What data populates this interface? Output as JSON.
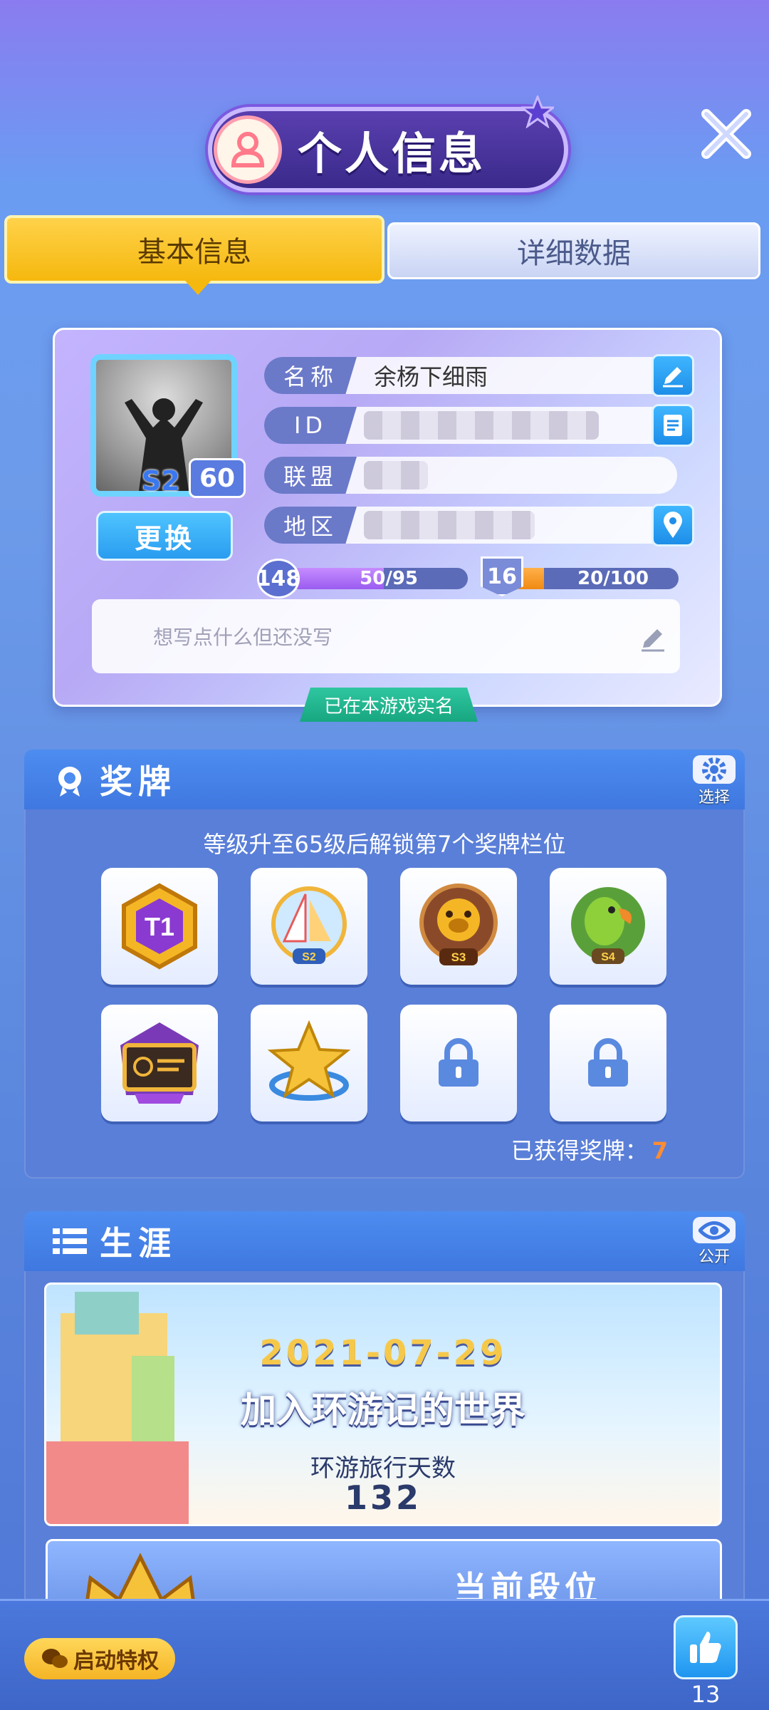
{
  "header": {
    "title": "个人信息"
  },
  "tabs": [
    {
      "label": "基本信息",
      "active": true
    },
    {
      "label": "详细数据",
      "active": false
    }
  ],
  "profile": {
    "avatar_level": "60",
    "avatar_season": "S2",
    "change_label": "更换",
    "rows": [
      {
        "label": "名称",
        "value": "余杨下细雨"
      },
      {
        "label": "ID",
        "value": ""
      },
      {
        "label": "联盟",
        "value": ""
      },
      {
        "label": "地区",
        "value": ""
      }
    ],
    "level_badge": "148",
    "level_progress_text": "50/95",
    "level_progress": 0.526,
    "rank_badge": "16",
    "rank_progress_text": "20/100",
    "rank_progress": 0.2,
    "signature_placeholder": "想写点什么但还没写",
    "verified_label": "已在本游戏实名"
  },
  "medals": {
    "title": "奖牌",
    "select_label": "选择",
    "hint": "等级升至65级后解锁第7个奖牌栏位",
    "items": [
      {
        "icon": "t1-medal-icon",
        "text": "T1",
        "locked": false
      },
      {
        "icon": "sailboat-s2-medal-icon",
        "text": "S2",
        "locked": false
      },
      {
        "icon": "pig-s3-medal-icon",
        "text": "S3",
        "locked": false
      },
      {
        "icon": "parrot-s4-medal-icon",
        "text": "S4",
        "locked": false
      },
      {
        "icon": "certificate-medal-icon",
        "text": "",
        "locked": false
      },
      {
        "icon": "star-medal-icon",
        "text": "",
        "locked": false
      },
      {
        "icon": "lock-icon",
        "text": "",
        "locked": true
      },
      {
        "icon": "lock-icon",
        "text": "",
        "locked": true
      }
    ],
    "count_label": "已获得奖牌：",
    "count_value": "7"
  },
  "career": {
    "title": "生涯",
    "visibility_label": "公开",
    "date": "2021-07-29",
    "join_text": "加入环游记的世界",
    "days_label": "环游旅行天数",
    "days_value": "132",
    "next_title": "当前段位"
  },
  "bottom": {
    "privilege_label": "启动特权",
    "like_count": "13"
  },
  "colors": {
    "accent_yellow": "#f5b80e",
    "panel_blue": "#5a7fd8",
    "button_blue": "#2a9cf0",
    "verified_green": "#17a680"
  }
}
